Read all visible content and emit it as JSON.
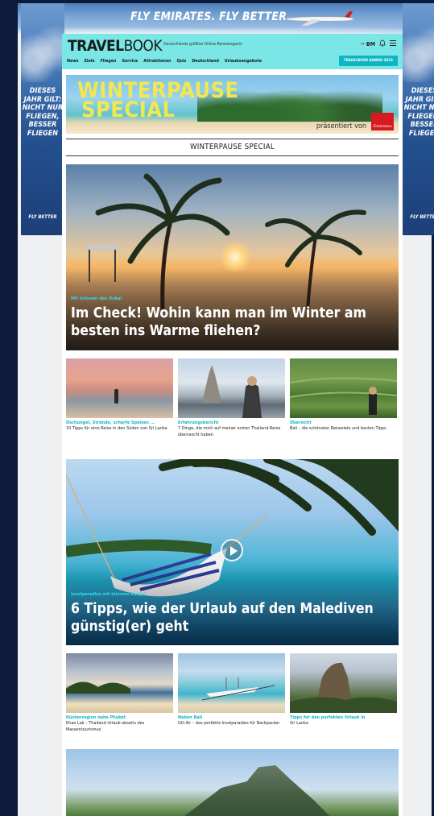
{
  "ads": {
    "top_slogan": "FLY EMIRATES. FLY BETTER.",
    "brand": "Emirates",
    "side_text_lines": [
      "DIESES",
      "JAHR GILT:",
      "NICHT NUR",
      "FLIEGEN,",
      "BESSER",
      "FLIEGEN"
    ],
    "side_fly": "FLY BETTER"
  },
  "header": {
    "logo_bold": "TRAVEL",
    "logo_light": "BOOK",
    "tagline": "Deutschlands größtes Online-Reisemagazin",
    "award_button": "TRAVELBOOK AWARD 2023",
    "icons": [
      "bm-logo",
      "bell-icon",
      "menu-icon"
    ],
    "bm_label": "BM"
  },
  "nav": [
    "News",
    "Ziele",
    "Fliegen",
    "Service",
    "Attraktionen",
    "Quiz",
    "Deutschland",
    "Urlaubsangebote"
  ],
  "promo": {
    "title_line1": "WINTERPAUSE",
    "title_line2": "SPECIAL",
    "presented_by": "präsentiert von"
  },
  "section_title": "WINTERPAUSE SPECIAL",
  "hero1": {
    "kicker": "Mit Infoseer des Dubai",
    "headline": "Im Check! Wohin kann man im Winter am besten ins Warme fliehen?"
  },
  "cards1": [
    {
      "kicker": "Dschungel, Strände, scharfe Speisen ...",
      "title": "10 Tipps für eine Reise in den Süden von Sri Lanka"
    },
    {
      "kicker": "Erfahrungsbericht",
      "title": "7 Dinge, die mich auf meiner ersten Thailand-Reise überrascht haben"
    },
    {
      "kicker": "Übersicht",
      "title": "Bali – die schönsten Reiseziele und besten Tipps"
    }
  ],
  "hero2": {
    "kicker": "Inselparadies mit kleinem Budget",
    "headline": "6 Tipps, wie der Urlaub auf den Malediven günstig(er) geht"
  },
  "cards2": [
    {
      "kicker": "Küstenregion nahe Phuket",
      "title": "Khao Lak – Thailand-Urlaub abseits des Massentourismus'"
    },
    {
      "kicker": "Neben Bali",
      "title": "Gili Air – das perfekte Inselparadies für Backpacker"
    },
    {
      "kicker": "Tipps für den perfekten Urlaub in",
      "title": "Sri Lanka"
    }
  ]
}
